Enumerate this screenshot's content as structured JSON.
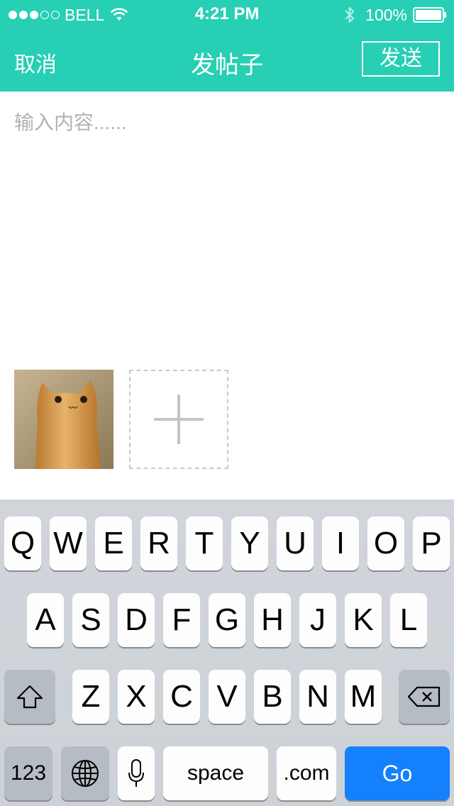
{
  "status_bar": {
    "carrier": "BELL",
    "time": "4:21 PM",
    "battery": "100%",
    "signal_filled": 3,
    "signal_total": 5
  },
  "nav": {
    "cancel_label": "取消",
    "title": "发帖子",
    "send_label": "发送"
  },
  "editor": {
    "placeholder": "输入内容......",
    "value": ""
  },
  "colors": {
    "accent": "#27cfb4",
    "go_key": "#1480fb"
  },
  "keyboard": {
    "row1": [
      "Q",
      "W",
      "E",
      "R",
      "T",
      "Y",
      "U",
      "I",
      "O",
      "P"
    ],
    "row2": [
      "A",
      "S",
      "D",
      "F",
      "G",
      "H",
      "J",
      "K",
      "L"
    ],
    "row3": [
      "Z",
      "X",
      "C",
      "V",
      "B",
      "N",
      "M"
    ],
    "numbers_label": "123",
    "space_label": "space",
    "dotcom_label": ".com",
    "go_label": "Go"
  }
}
